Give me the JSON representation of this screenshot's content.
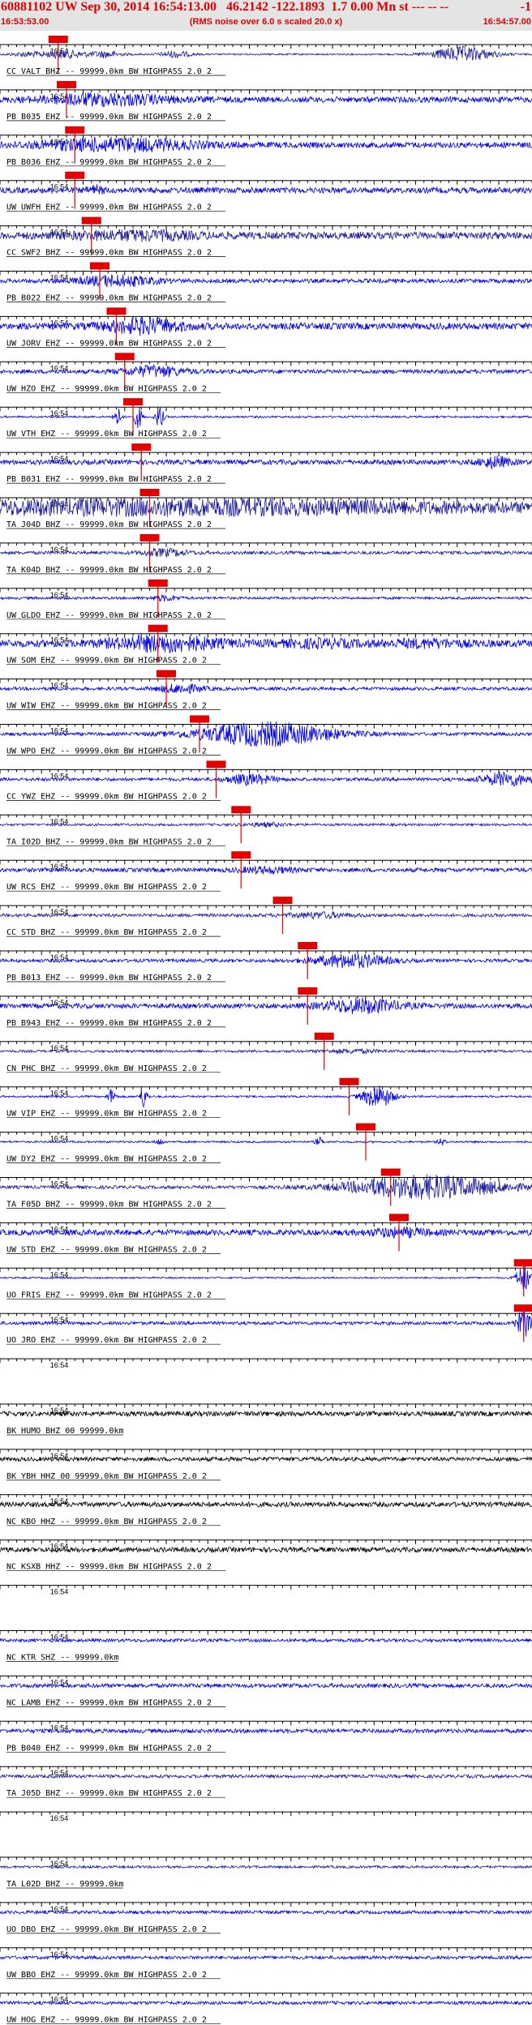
{
  "header": {
    "title": "60881102 UW Sep 30, 2014 16:54:13.00   46.2142 -122.1893  1.7 0.00 Mn st --- -- --",
    "right": "-1",
    "start_time": "16:53:53.00",
    "rms_note": "(RMS noise over 6.0 s scaled 20.0 x)",
    "end_time": "16:54:57.00"
  },
  "colors": {
    "pick": "#e00000",
    "header_bg": "#e4e4e4",
    "axis": "#000000"
  },
  "chart_data": {
    "type": "seismogram",
    "time_range": [
      "16:53:53.00",
      "16:54:57.00"
    ],
    "minute_label": "16:54",
    "traces": [
      {
        "label": "CC VALT BHZ -- 99999.0km BW  HIGHPASS  2.0  2",
        "color": "#1a1a9a",
        "pick_time": "16:54:00",
        "noise": 1.0,
        "bursts": [
          [
            0.05,
            2.5,
            0.02
          ],
          [
            0.12,
            5,
            0.03
          ],
          [
            0.2,
            4,
            0.02
          ],
          [
            0.33,
            4,
            0.02
          ],
          [
            0.87,
            9,
            0.04
          ]
        ]
      },
      {
        "label": "PB B035 EHZ -- 99999.0km BW  HIGHPASS  2.0  2",
        "color": "#0000dd",
        "pick_time": "16:54:01",
        "noise": 3.5,
        "bursts": [
          [
            0.2,
            6,
            0.08
          ]
        ]
      },
      {
        "label": "PB B036 EHZ -- 99999.0km BW  HIGHPASS  2.0  2",
        "color": "#0000dd",
        "pick_time": "16:54:02",
        "noise": 3.5,
        "bursts": [
          [
            0.22,
            7,
            0.1
          ]
        ]
      },
      {
        "label": "UW UWFH EHZ -- 99999.0km BW  HIGHPASS  2.0  2",
        "color": "#0000dd",
        "pick_time": "16:54:02",
        "noise": 3.5,
        "bursts": [
          [
            0.18,
            4,
            0.01
          ]
        ]
      },
      {
        "label": "CC SWF2 BHZ -- 99999.0km BW  HIGHPASS  2.0  2",
        "color": "#1a1a9a",
        "pick_time": "16:54:04",
        "noise": 4.5,
        "bursts": [
          [
            0.25,
            4,
            0.08
          ]
        ]
      },
      {
        "label": "PB B022 EHZ -- 99999.0km BW  HIGHPASS  2.0  2",
        "color": "#0000dd",
        "pick_time": "16:54:05",
        "noise": 2.5,
        "bursts": [
          [
            0.22,
            6,
            0.05
          ]
        ]
      },
      {
        "label": "UW JORV EHZ -- 99999.0km BW  HIGHPASS  2.0  2",
        "color": "#0000dd",
        "pick_time": "16:54:07",
        "noise": 4.0,
        "bursts": [
          [
            0.27,
            8,
            0.05
          ]
        ]
      },
      {
        "label": "UW HZO EHZ -- 99999.0km BW  HIGHPASS  2.0  2",
        "color": "#0000dd",
        "pick_time": "16:54:08",
        "noise": 2.5,
        "bursts": [
          [
            0.29,
            6,
            0.04
          ]
        ]
      },
      {
        "label": "UW VTH EHZ -- 99999.0km BW  HIGHPASS  2.0  2",
        "color": "#0000dd",
        "pick_time": "16:54:09",
        "noise": 1.2,
        "bursts": [
          [
            0.22,
            12,
            0.005
          ],
          [
            0.26,
            14,
            0.005
          ],
          [
            0.3,
            14,
            0.005
          ]
        ]
      },
      {
        "label": "PB B031 EHZ -- 99999.0km BW  HIGHPASS  2.0  2",
        "color": "#0000dd",
        "pick_time": "16:54:10",
        "noise": 3.0,
        "bursts": [
          [
            0.93,
            6,
            0.02
          ]
        ]
      },
      {
        "label": "TA J04D BHZ -- 99999.0km BW  HIGHPASS  2.0  2",
        "color": "#1a1a9a",
        "pick_time": "16:54:11",
        "noise": 4.0,
        "bursts": [
          [
            0.3,
            8,
            0.5
          ]
        ]
      },
      {
        "label": "TA K04D BHZ -- 99999.0km BW  HIGHPASS  2.0  2",
        "color": "#1a1a9a",
        "pick_time": "16:54:11",
        "noise": 2.0,
        "bursts": [
          [
            0.31,
            4,
            0.03
          ]
        ]
      },
      {
        "label": "UW GLDO EHZ -- 99999.0km BW  HIGHPASS  2.0  2",
        "color": "#0000dd",
        "pick_time": "16:54:12",
        "noise": 1.5,
        "bursts": [
          [
            0.31,
            3,
            0.02
          ]
        ]
      },
      {
        "label": "UW SOM EHZ -- 99999.0km BW  HIGHPASS  2.0  2",
        "color": "#0000dd",
        "pick_time": "16:54:12",
        "noise": 4.5,
        "bursts": [
          [
            0.31,
            8,
            0.07
          ],
          [
            0.6,
            3,
            0.05
          ],
          [
            0.8,
            3,
            0.05
          ]
        ]
      },
      {
        "label": "UW WIW EHZ -- 99999.0km BW  HIGHPASS  2.0  2",
        "color": "#0000dd",
        "pick_time": "16:54:13",
        "noise": 2.0,
        "bursts": [
          [
            0.34,
            5,
            0.03
          ]
        ]
      },
      {
        "label": "UW WPO EHZ -- 99999.0km BW  HIGHPASS  2.0  2",
        "color": "#0000dd",
        "pick_time": "16:54:17",
        "noise": 2.0,
        "bursts": [
          [
            0.5,
            14,
            0.09
          ]
        ]
      },
      {
        "label": "CC YWZ EHZ -- 99999.0km BW  HIGHPASS  2.0  2",
        "color": "#0000dd",
        "pick_time": "16:54:19",
        "noise": 2.0,
        "bursts": [
          [
            0.47,
            6,
            0.03
          ],
          [
            0.95,
            8,
            0.03
          ]
        ]
      },
      {
        "label": "TA I02D BHZ -- 99999.0km BW  HIGHPASS  2.0  2",
        "color": "#1a1a9a",
        "pick_time": "16:54:22",
        "noise": 1.5,
        "bursts": [
          [
            0.5,
            2,
            0.03
          ]
        ]
      },
      {
        "label": "UW RCS EHZ -- 99999.0km BW  HIGHPASS  2.0  2",
        "color": "#0000dd",
        "pick_time": "16:54:22",
        "noise": 2.5,
        "bursts": [
          [
            0.5,
            3,
            0.04
          ]
        ]
      },
      {
        "label": "CC STD BHZ -- 99999.0km BW  HIGHPASS  2.0  2",
        "color": "#1a1a9a",
        "pick_time": "16:54:27",
        "noise": 2.0,
        "bursts": [
          [
            0.6,
            3,
            0.04
          ]
        ]
      },
      {
        "label": "PB B013 EHZ -- 99999.0km BW  HIGHPASS  2.0  2",
        "color": "#0000dd",
        "pick_time": "16:54:30",
        "noise": 2.0,
        "bursts": [
          [
            0.66,
            8,
            0.05
          ]
        ]
      },
      {
        "label": "PB B943 EHZ -- 99999.0km BW  HIGHPASS  2.0  2",
        "color": "#0000dd",
        "pick_time": "16:54:30",
        "noise": 3.0,
        "bursts": [
          [
            0.68,
            8,
            0.05
          ]
        ]
      },
      {
        "label": "CN PHC BHZ -- 99999.0km BW  HIGHPASS  2.0  2",
        "color": "#1a1a9a",
        "pick_time": "16:54:32",
        "noise": 1.5,
        "bursts": [
          [
            0.66,
            2,
            0.04
          ]
        ]
      },
      {
        "label": "UW VIP EHZ -- 99999.0km BW  HIGHPASS  2.0  2",
        "color": "#0000dd",
        "pick_time": "16:54:35",
        "noise": 1.2,
        "bursts": [
          [
            0.21,
            10,
            0.005
          ],
          [
            0.27,
            14,
            0.005
          ],
          [
            0.71,
            14,
            0.02
          ]
        ]
      },
      {
        "label": "UW DY2 EHZ -- 99999.0km BW  HIGHPASS  2.0  2",
        "color": "#0000dd",
        "pick_time": "16:54:37",
        "noise": 1.2,
        "bursts": [
          [
            0.3,
            4,
            0.005
          ],
          [
            0.6,
            5,
            0.005
          ],
          [
            0.83,
            4,
            0.005
          ]
        ]
      },
      {
        "label": "TA F05D BHZ -- 99999.0km BW  HIGHPASS  2.0  2",
        "color": "#1a1a9a",
        "pick_time": "16:54:40",
        "noise": 2.0,
        "bursts": [
          [
            0.8,
            14,
            0.1
          ]
        ]
      },
      {
        "label": "UW STD EHZ -- 99999.0km BW  HIGHPASS  2.0  2",
        "color": "#0000dd",
        "pick_time": "16:54:41",
        "noise": 3.5,
        "bursts": [
          [
            0.75,
            4,
            0.04
          ]
        ]
      },
      {
        "label": "UO FRIS EHZ -- 99999.0km BW  HIGHPASS  2.0  2",
        "color": "#0000dd",
        "pick_time": "16:54:56",
        "noise": 1.0,
        "bursts": [
          [
            0.985,
            16,
            0.01
          ]
        ]
      },
      {
        "label": "UO JRO EHZ -- 99999.0km BW  HIGHPASS  2.0  2",
        "color": "#0000dd",
        "pick_time": "16:54:56",
        "noise": 2.0,
        "bursts": [
          [
            0.985,
            16,
            0.01
          ]
        ]
      },
      {
        "label": "",
        "color": "#0000dd",
        "pick_time": null,
        "noise": 0,
        "bursts": []
      },
      {
        "label": "BK HUMO BHZ 00 99999.0km",
        "color": "#000000",
        "pick_time": null,
        "noise": 3.0,
        "bursts": []
      },
      {
        "label": "BK YBH HHZ 00 99999.0km BW  HIGHPASS  2.0  2",
        "color": "#000000",
        "pick_time": null,
        "noise": 2.5,
        "bursts": []
      },
      {
        "label": "NC KBO HHZ -- 99999.0km BW  HIGHPASS  2.0  2",
        "color": "#000000",
        "pick_time": null,
        "noise": 3.0,
        "bursts": []
      },
      {
        "label": "NC KSXB HHZ -- 99999.0km BW  HIGHPASS  2.0  2",
        "color": "#000000",
        "pick_time": null,
        "noise": 3.0,
        "bursts": []
      },
      {
        "label": "",
        "color": "#0000dd",
        "pick_time": null,
        "noise": 0,
        "bursts": []
      },
      {
        "label": "NC KTR SHZ -- 99999.0km",
        "color": "#0000dd",
        "pick_time": null,
        "noise": 2.0,
        "bursts": []
      },
      {
        "label": "NC LAMB EHZ -- 99999.0km BW  HIGHPASS  2.0  2",
        "color": "#0000dd",
        "pick_time": null,
        "noise": 2.5,
        "bursts": []
      },
      {
        "label": "PB B040 EHZ -- 99999.0km BW  HIGHPASS  2.0  2",
        "color": "#0000dd",
        "pick_time": null,
        "noise": 2.5,
        "bursts": []
      },
      {
        "label": "TA J05D BHZ -- 99999.0km BW  HIGHPASS  2.0  2",
        "color": "#1a1a9a",
        "pick_time": null,
        "noise": 2.0,
        "bursts": []
      },
      {
        "label": "",
        "color": "#0000dd",
        "pick_time": null,
        "noise": 0,
        "bursts": []
      },
      {
        "label": "TA L02D BHZ -- 99999.0km",
        "color": "#1a1a9a",
        "pick_time": null,
        "noise": 1.5,
        "bursts": []
      },
      {
        "label": "UO DBO EHZ -- 99999.0km BW  HIGHPASS  2.0  2",
        "color": "#0000dd",
        "pick_time": null,
        "noise": 2.0,
        "bursts": []
      },
      {
        "label": "UW BBO EHZ -- 99999.0km BW  HIGHPASS  2.0  2",
        "color": "#0000dd",
        "pick_time": null,
        "noise": 2.0,
        "bursts": []
      },
      {
        "label": "UW HOG EHZ -- 99999.0km BW  HIGHPASS  2.0  2",
        "color": "#0000dd",
        "pick_time": null,
        "noise": 2.0,
        "bursts": []
      }
    ]
  }
}
